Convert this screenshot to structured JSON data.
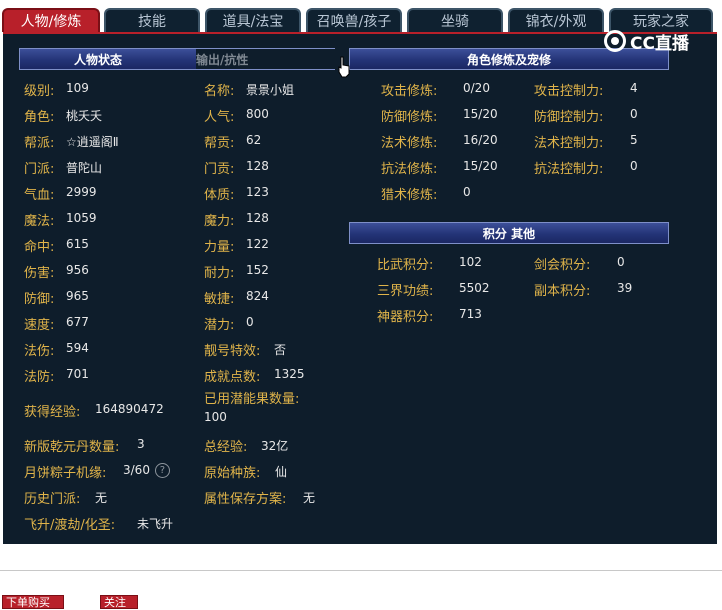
{
  "tabs": [
    "人物/修炼",
    "技能",
    "道具/法宝",
    "召唤兽/孩子",
    "坐骑",
    "锦衣/外观",
    "玩家之家"
  ],
  "logo": "CC直播",
  "panel_left": {
    "header": "人物状态",
    "header_alt": "输出/抗性",
    "left_col": [
      {
        "label": "级别:",
        "value": "109"
      },
      {
        "label": "角色:",
        "value": "桃夭夭"
      },
      {
        "label": "帮派:",
        "value": "☆逍遥阁Ⅱ"
      },
      {
        "label": "门派:",
        "value": "普陀山"
      },
      {
        "label": "气血:",
        "value": "2999"
      },
      {
        "label": "魔法:",
        "value": "1059"
      },
      {
        "label": "命中:",
        "value": "615"
      },
      {
        "label": "伤害:",
        "value": "956"
      },
      {
        "label": "防御:",
        "value": "965"
      },
      {
        "label": "速度:",
        "value": "677"
      },
      {
        "label": "法伤:",
        "value": "594"
      },
      {
        "label": "法防:",
        "value": "701"
      }
    ],
    "right_col": [
      {
        "label": "名称:",
        "value": "景景小姐"
      },
      {
        "label": "人气:",
        "value": "800"
      },
      {
        "label": "帮贡:",
        "value": "62"
      },
      {
        "label": "门贡:",
        "value": "128"
      },
      {
        "label": "体质:",
        "value": "123"
      },
      {
        "label": "魔力:",
        "value": "128"
      },
      {
        "label": "力量:",
        "value": "122"
      },
      {
        "label": "耐力:",
        "value": "152"
      },
      {
        "label": "敏捷:",
        "value": "824"
      },
      {
        "label": "潜力:",
        "value": "0"
      },
      {
        "label": "靓号特效:",
        "value": "否"
      },
      {
        "label": "成就点数:",
        "value": "1325"
      }
    ],
    "exp_label": "获得经验:",
    "exp_value": "164890472",
    "potion_label": "已用潜能果数量:",
    "potion_value": "100",
    "pill_label": "新版乾元丹数量:",
    "pill_value": "3",
    "total_exp_label": "总经验:",
    "total_exp_value": "32亿",
    "zongzi_label": "月饼粽子机缘:",
    "zongzi_value": "3/60",
    "help_icon": "?",
    "race_label": "原始种族:",
    "race_value": "仙",
    "history_label": "历史门派:",
    "history_value": "无",
    "attr_plan_label": "属性保存方案:",
    "attr_plan_value": "无",
    "fly_label": "飞升/渡劫/化圣:",
    "fly_value": "未飞升"
  },
  "panel_right": {
    "header": "角色修炼及宠修",
    "rows": [
      {
        "label": "攻击修炼:",
        "value": "0/20",
        "label2": "攻击控制力:",
        "value2": "4"
      },
      {
        "label": "防御修炼:",
        "value": "15/20",
        "label2": "防御控制力:",
        "value2": "0"
      },
      {
        "label": "法术修炼:",
        "value": "16/20",
        "label2": "法术控制力:",
        "value2": "5"
      },
      {
        "label": "抗法修炼:",
        "value": "15/20",
        "label2": "抗法控制力:",
        "value2": "0"
      },
      {
        "label": "猎术修炼:",
        "value": "0",
        "label2": "",
        "value2": ""
      }
    ],
    "header2": "积分 其他",
    "rows2": [
      {
        "label": "比武积分:",
        "value": "102",
        "label2": "剑会积分:",
        "value2": "0"
      },
      {
        "label": "三界功绩:",
        "value": "5502",
        "label2": "副本积分:",
        "value2": "39"
      },
      {
        "label": "神器积分:",
        "value": "713",
        "label2": "",
        "value2": ""
      }
    ]
  },
  "footer": {
    "btn1": "下单购买",
    "btn2": "关注"
  }
}
